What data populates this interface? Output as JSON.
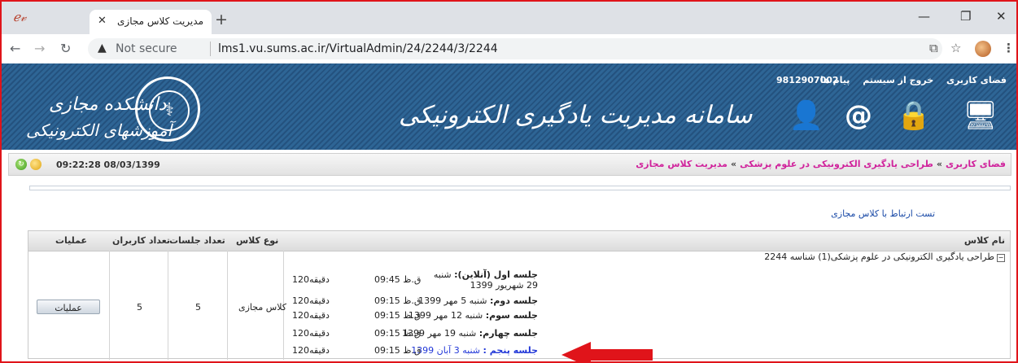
{
  "browser": {
    "tab_title": "مدیریت کلاس مجازی",
    "url_warning": "Not secure",
    "url": "lms1.vu.sums.ac.ir/VirtualAdmin/24/2244/3/2244"
  },
  "banner": {
    "links": [
      "فضای کاربری",
      "خروج از سیستم",
      "پیام ها"
    ],
    "phone": "9812907002",
    "title": "سامانه مدیریت یادگیری الکترونیکی",
    "university_line1": "دانشکده مجازی",
    "university_line2": "آموزشهای الکترونیکی"
  },
  "breadcrumb": {
    "home": "فضای کاربری",
    "course": "طراحی یادگیری الکترونیکی در علوم پزشکی",
    "current": "مدیریت کلاس مجازی",
    "separator": "»",
    "clock": "09:22:28 08/03/1399"
  },
  "test_link": "تست ارتباط با کلاس مجازی",
  "table": {
    "headers": {
      "class_name": "نام کلاس",
      "class_type": "نوع کلاس",
      "session_count": "تعداد جلسات",
      "user_count": "تعداد کاربران",
      "operations": "عملیات"
    },
    "row": {
      "course": "طراحی یادگیری الکترونیکی در علوم پزشکی(1) شناسه 2244",
      "class_type": "کلاس مجازی",
      "session_count": "5",
      "user_count": "5",
      "ops_button": "عملیات",
      "sessions": [
        {
          "label": "جلسه اول (آنلاین):",
          "date": "شنبه 29 شهریور 1399",
          "time": "09:45 ق.ظ",
          "duration": "120دقیقه"
        },
        {
          "label": "جلسه دوم:",
          "date": "شنبه 5 مهر 1399",
          "time": "09:15 ق.ظ",
          "duration": "120دقیقه"
        },
        {
          "label": "جلسه سوم:",
          "date": "شنبه 12 مهر 1399",
          "time": "09:15 ق.ظ",
          "duration": "120دقیقه"
        },
        {
          "label": "جلسه چهارم:",
          "date": "شنبه 19 مهر 1399",
          "time": "09:15 ق.ظ",
          "duration": "120دقیقه"
        },
        {
          "label": "جلسه پنجم :",
          "date": "شنبه 3 آبان 1399",
          "time": "09:15 ق.ظ",
          "duration": "120دقیقه"
        }
      ]
    }
  },
  "colors": {
    "highlight_arrow": "#e0141a",
    "link_pink": "#d0239c",
    "banner_blue": "#2e6595"
  }
}
